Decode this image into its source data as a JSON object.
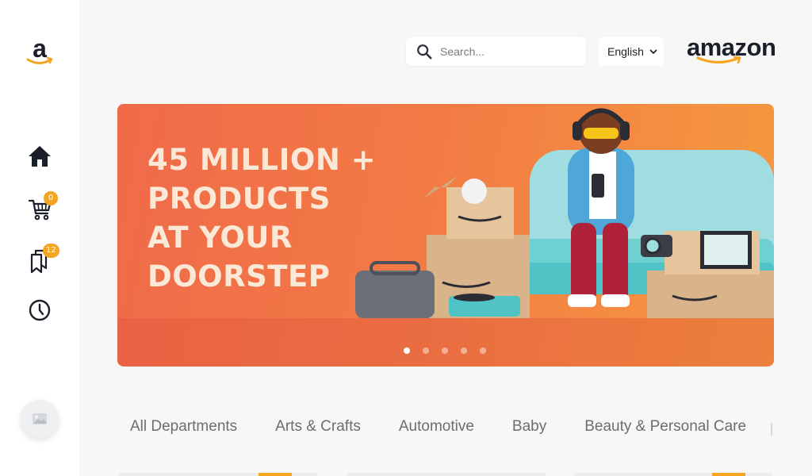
{
  "sidebar": {
    "logo_icon": "amazon-a-logo",
    "nav": [
      {
        "id": "home",
        "icon": "home-icon"
      },
      {
        "id": "cart",
        "icon": "cart-icon",
        "badge": "0"
      },
      {
        "id": "saved",
        "icon": "bookmarks-icon",
        "badge": "12"
      },
      {
        "id": "history",
        "icon": "clock-icon"
      }
    ],
    "avatar_icon": "image-placeholder-icon"
  },
  "header": {
    "search_placeholder": "Search...",
    "language": "English",
    "brand": "amazon"
  },
  "banner": {
    "headline_lines": [
      "45 MILLION +",
      "PRODUCTS",
      "AT YOUR",
      "DOORSTEP"
    ],
    "slide_count": 5,
    "active_slide": 1
  },
  "categories": [
    "All Departments",
    "Arts & Crafts",
    "Automotive",
    "Baby",
    "Beauty & Personal Care"
  ],
  "colors": {
    "accent": "#f4a623",
    "banner_start": "#f06a4a",
    "banner_end": "#f59a3e",
    "sidebar_icons": "#1b1f2a"
  }
}
